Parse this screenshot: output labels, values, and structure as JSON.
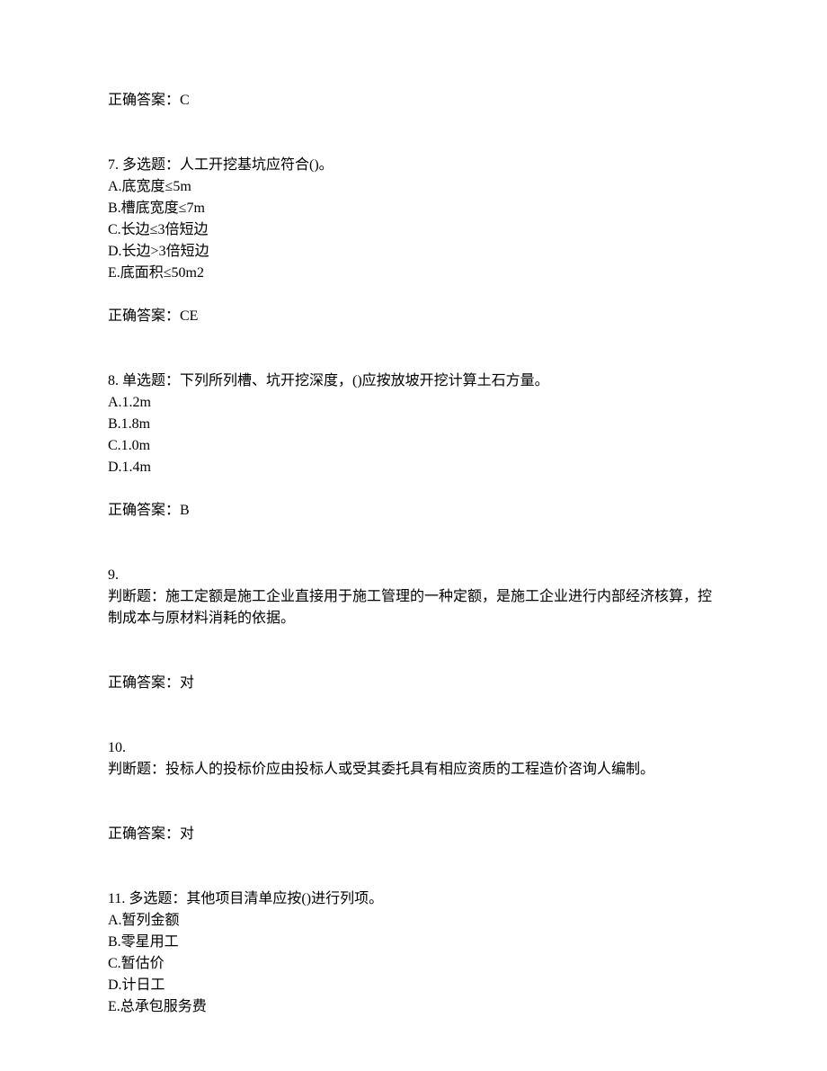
{
  "q6": {
    "answer": "正确答案：C"
  },
  "q7": {
    "header": "7. 多选题：人工开挖基坑应符合()。",
    "optA": "A.底宽度≤5m",
    "optB": "B.槽底宽度≤7m",
    "optC": "C.长边≤3倍短边",
    "optD": "D.长边>3倍短边",
    "optE": "E.底面积≤50m2",
    "answer": "正确答案：CE"
  },
  "q8": {
    "header": "8. 单选题：下列所列槽、坑开挖深度，()应按放坡开挖计算土石方量。",
    "optA": "A.1.2m",
    "optB": "B.1.8m",
    "optC": "C.1.0m",
    "optD": "D.1.4m",
    "answer": "正确答案：B"
  },
  "q9": {
    "num": "9.",
    "header": "判断题：施工定额是施工企业直接用于施工管理的一种定额，是施工企业进行内部经济核算，控制成本与原材料消耗的依据。",
    "answer": "正确答案：对"
  },
  "q10": {
    "num": "10.",
    "header": "判断题：投标人的投标价应由投标人或受其委托具有相应资质的工程造价咨询人编制。",
    "answer": "正确答案：对"
  },
  "q11": {
    "header": "11. 多选题：其他项目清单应按()进行列项。",
    "optA": "A.暂列金额",
    "optB": "B.零星用工",
    "optC": "C.暂估价",
    "optD": "D.计日工",
    "optE": "E.总承包服务费"
  }
}
